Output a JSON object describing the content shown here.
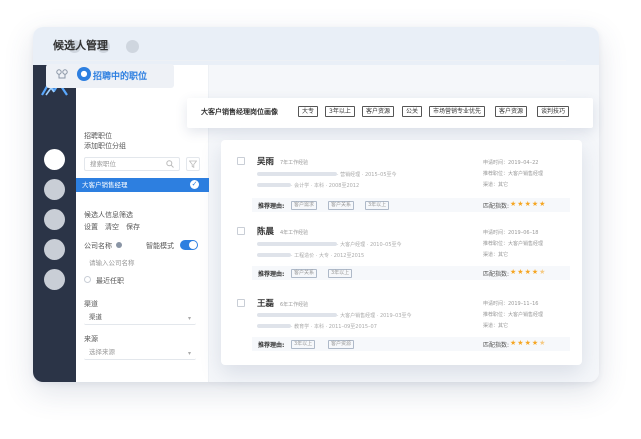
{
  "page": {
    "title": "候选人管理"
  },
  "sidebar": {
    "segment_label": "招聘中的职位",
    "position_label": "招聘职位",
    "add_group_link": "添加职位分组",
    "search_placeholder": "搜索职位",
    "selected_job": "大客户销售经理",
    "filter_section_label": "候选人信息筛选",
    "actions": [
      "设置",
      "清空",
      "保存"
    ],
    "company_label": "公司名称",
    "smart_mode_label": "智能模式",
    "company_placeholder": "请输入公司名称",
    "recent_job_label": "最近任职",
    "channel_label": "渠道",
    "channel_value": "渠道",
    "source_label": "来源",
    "source_placeholder": "选择来源"
  },
  "portrait": {
    "title": "大客户销售经理岗位画像",
    "tags": [
      "大专",
      "3年以上",
      "客户资源",
      "公关",
      "市场营销专业优先",
      "客户资源",
      "谈判技巧"
    ]
  },
  "candidates": [
    {
      "name": "吴雨",
      "experience": "7年工作经验",
      "line1": "· 营销经理 · 2015–05至今",
      "line2": "· 会计学 · 本科 · 2008至2012",
      "reason_label": "推荐理由:",
      "reasons": [
        "客户需求",
        "客户关系",
        "3年以上"
      ],
      "submit_time": "申请时间：2019–04–22",
      "applied_job": "推荐职位：大客户销售经理",
      "channel": "渠道：其它",
      "match_label": "匹配指数:",
      "rating": 5
    },
    {
      "name": "陈晨",
      "experience": "4年工作经验",
      "line1": "· 大客户经理 · 2010–05至今",
      "line2": "· 工程造价 · 大专 · 2012至2015",
      "reason_label": "推荐理由:",
      "reasons": [
        "客户关系",
        "3年以上"
      ],
      "submit_time": "申请时间：2019–06–18",
      "applied_job": "推荐职位：大客户销售经理",
      "channel": "渠道：其它",
      "match_label": "匹配指数:",
      "rating": 4.5
    },
    {
      "name": "王磊",
      "experience": "6年工作经验",
      "line1": "· 大客户销售经理 · 2019–03至今",
      "line2": "· 教育学 · 本科 · 2011–09至2015–07",
      "reason_label": "推荐理由:",
      "reasons": [
        "3年以上",
        "客户资源"
      ],
      "submit_time": "申请时间：2019–11–16",
      "applied_job": "推荐职位：大客户销售经理",
      "channel": "渠道：其它",
      "match_label": "匹配指数:",
      "rating": 4.5
    }
  ],
  "colors": {
    "accent": "#2d7fe0",
    "nav_dark": "#2b3447",
    "star": "#f5a623"
  }
}
